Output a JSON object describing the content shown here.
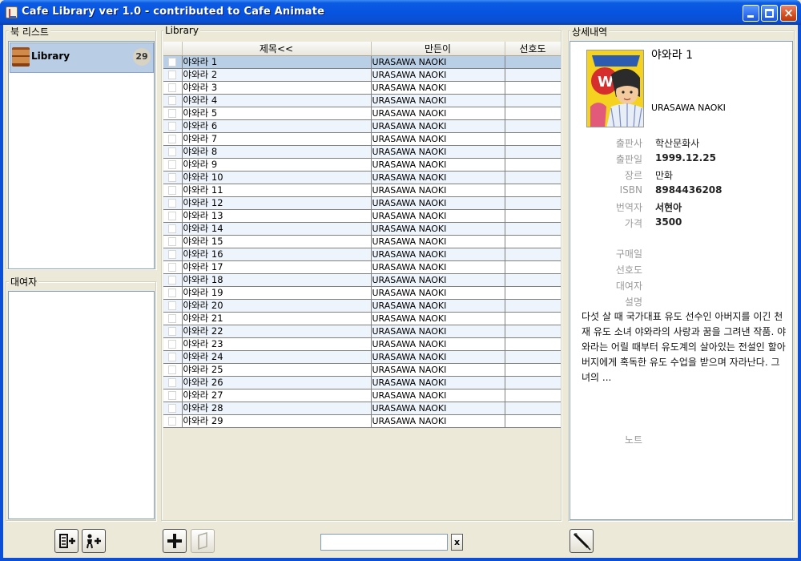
{
  "window": {
    "title": "Cafe Library ver 1.0 - contributed to Cafe Animate",
    "close_glyph": "×"
  },
  "bookshelf": {
    "title": "북 리스트",
    "items": [
      {
        "label": "Library",
        "count": "29",
        "icon": "bookshelf-icon"
      }
    ]
  },
  "borrowers": {
    "title": "대여자"
  },
  "library": {
    "title": "Library",
    "columns": [
      {
        "label": ""
      },
      {
        "label": "제목<<"
      },
      {
        "label": "만든이"
      },
      {
        "label": "선호도"
      }
    ],
    "rows": [
      {
        "title": "야와라 1",
        "author": "URASAWA NAOKI",
        "rating": ""
      },
      {
        "title": "야와라 2",
        "author": "URASAWA NAOKI",
        "rating": ""
      },
      {
        "title": "야와라 3",
        "author": "URASAWA NAOKI",
        "rating": ""
      },
      {
        "title": "야와라 4",
        "author": "URASAWA NAOKI",
        "rating": ""
      },
      {
        "title": "야와라 5",
        "author": "URASAWA NAOKI",
        "rating": ""
      },
      {
        "title": "야와라 6",
        "author": "URASAWA NAOKI",
        "rating": ""
      },
      {
        "title": "야와라 7",
        "author": "URASAWA NAOKI",
        "rating": ""
      },
      {
        "title": "야와라 8",
        "author": "URASAWA NAOKI",
        "rating": ""
      },
      {
        "title": "야와라 9",
        "author": "URASAWA NAOKI",
        "rating": ""
      },
      {
        "title": "야와라 10",
        "author": "URASAWA NAOKI",
        "rating": ""
      },
      {
        "title": "야와라 11",
        "author": "URASAWA NAOKI",
        "rating": ""
      },
      {
        "title": "야와라 12",
        "author": "URASAWA NAOKI",
        "rating": ""
      },
      {
        "title": "야와라 13",
        "author": "URASAWA NAOKI",
        "rating": ""
      },
      {
        "title": "야와라 14",
        "author": "URASAWA NAOKI",
        "rating": ""
      },
      {
        "title": "야와라 15",
        "author": "URASAWA NAOKI",
        "rating": ""
      },
      {
        "title": "야와라 16",
        "author": "URASAWA NAOKI",
        "rating": ""
      },
      {
        "title": "야와라 17",
        "author": "URASAWA NAOKI",
        "rating": ""
      },
      {
        "title": "야와라 18",
        "author": "URASAWA NAOKI",
        "rating": ""
      },
      {
        "title": "야와라 19",
        "author": "URASAWA NAOKI",
        "rating": ""
      },
      {
        "title": "야와라 20",
        "author": "URASAWA NAOKI",
        "rating": ""
      },
      {
        "title": "야와라 21",
        "author": "URASAWA NAOKI",
        "rating": ""
      },
      {
        "title": "야와라 22",
        "author": "URASAWA NAOKI",
        "rating": ""
      },
      {
        "title": "야와라 23",
        "author": "URASAWA NAOKI",
        "rating": ""
      },
      {
        "title": "야와라 24",
        "author": "URASAWA NAOKI",
        "rating": ""
      },
      {
        "title": "야와라 25",
        "author": "URASAWA NAOKI",
        "rating": ""
      },
      {
        "title": "야와라 26",
        "author": "URASAWA NAOKI",
        "rating": ""
      },
      {
        "title": "야와라 27",
        "author": "URASAWA NAOKI",
        "rating": ""
      },
      {
        "title": "야와라 28",
        "author": "URASAWA NAOKI",
        "rating": ""
      },
      {
        "title": "야와라 29",
        "author": "URASAWA NAOKI",
        "rating": ""
      }
    ],
    "selected_index": 0
  },
  "detail": {
    "title": "상세내역",
    "book_title": "야와라 1",
    "author": "URASAWA NAOKI",
    "fields": [
      {
        "label": "출판사",
        "value": "학산문화사",
        "bold": false
      },
      {
        "label": "출판일",
        "value": "1999.12.25",
        "bold": true
      },
      {
        "label": "장르",
        "value": "만화",
        "bold": false
      },
      {
        "label": "ISBN",
        "value": "8984436208",
        "bold": true
      },
      {
        "label": "번역자",
        "value": "서현아",
        "bold": true
      },
      {
        "label": "가격",
        "value": "3500",
        "bold": true
      }
    ],
    "extra_fields": [
      {
        "label": "구매일",
        "value": ""
      },
      {
        "label": "선호도",
        "value": ""
      },
      {
        "label": "대여자",
        "value": ""
      },
      {
        "label": "설명",
        "value": ""
      }
    ],
    "description": "다섯 살 때 국가대표 유도 선수인 아버지를 이긴 천재 유도 소녀 야와라의 사랑과 꿈을 그려낸 작품. 야와라는 어릴 때부터 유도계의 살아있는 전설인 할아버지에게 혹독한 유도 수업을 받으며 자라난다. 그녀의 ...",
    "note_label": "노트"
  },
  "toolbar": {
    "search_value": "",
    "clear_label": "x"
  },
  "colors": {
    "selection": "#b8cfe5",
    "alt_row": "#eef4fb",
    "titlebar": "#0754e0",
    "cover_yellow": "#f4d21f"
  }
}
